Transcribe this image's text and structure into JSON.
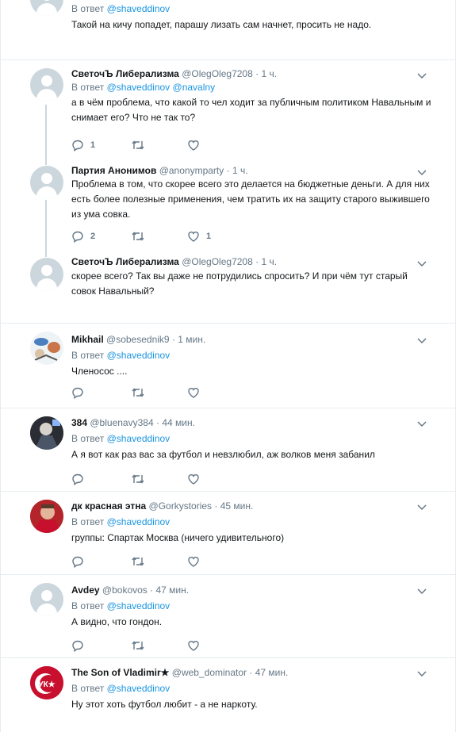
{
  "labels": {
    "reply_prefix": "В ответ"
  },
  "tweets": [
    {
      "name": "",
      "handle": "",
      "time": "",
      "mentions": [
        "@shaveddinov"
      ],
      "text": "Такой на кичу попадет, парашу лизать сам начнет, просить не надо.",
      "replies": "",
      "retweets": "",
      "likes": ""
    },
    {
      "name": "СветочЪ Либерализма",
      "handle": "@OlegOleg7208",
      "time": "1 ч.",
      "mentions": [
        "@shaveddinov",
        "@navalny"
      ],
      "text": "а в чём проблема, что какой то чел ходит за публичным политиком Навальным и снимает его? Что не так то?",
      "replies": "1",
      "retweets": "",
      "likes": ""
    },
    {
      "name": "Партия Анонимов",
      "handle": "@anonymparty",
      "time": "1 ч.",
      "mentions": [],
      "text": "Проблема в том, что скорее всего это делается на бюджетные деньги. А для них есть более полезные применения, чем тратить их на защиту старого выжившего из ума совка.",
      "replies": "2",
      "retweets": "",
      "likes": "1"
    },
    {
      "name": "СветочЪ Либерализма",
      "handle": "@OlegOleg7208",
      "time": "1 ч.",
      "mentions": [],
      "text": "скорее всего? Так вы даже не потрудились спросить? И при чём тут старый совок Навальный?",
      "replies": "",
      "retweets": "",
      "likes": ""
    },
    {
      "name": "Mikhail",
      "handle": "@sobesednik9",
      "time": "1 мин.",
      "mentions": [
        "@shaveddinov"
      ],
      "text": "Членосос ....",
      "replies": "",
      "retweets": "",
      "likes": ""
    },
    {
      "name": "384",
      "handle": "@bluenavy384",
      "time": "44 мин.",
      "mentions": [
        "@shaveddinov"
      ],
      "text": "А я вот как раз вас за футбол и невзлюбил, аж волков меня забанил",
      "replies": "",
      "retweets": "",
      "likes": ""
    },
    {
      "name": "дк красная этна",
      "handle": "@Gorkystories",
      "time": "45 мин.",
      "mentions": [
        "@shaveddinov"
      ],
      "text": "группы: Спартак Москва (ничего удивительного)",
      "replies": "",
      "retweets": "",
      "likes": ""
    },
    {
      "name": "Avdey",
      "handle": "@bokovos",
      "time": "47 мин.",
      "mentions": [
        "@shaveddinov"
      ],
      "text": "А видно, что гондон.",
      "replies": "",
      "retweets": "",
      "likes": ""
    },
    {
      "name": "The Son of Vladimir★",
      "handle": "@web_dominator",
      "time": "47 мин.",
      "mentions": [
        "@shaveddinov"
      ],
      "text": "Ну этот хоть футбол любит - а не наркоту.",
      "replies": "",
      "retweets": "",
      "likes": "",
      "avatar_text": "УК★"
    }
  ]
}
